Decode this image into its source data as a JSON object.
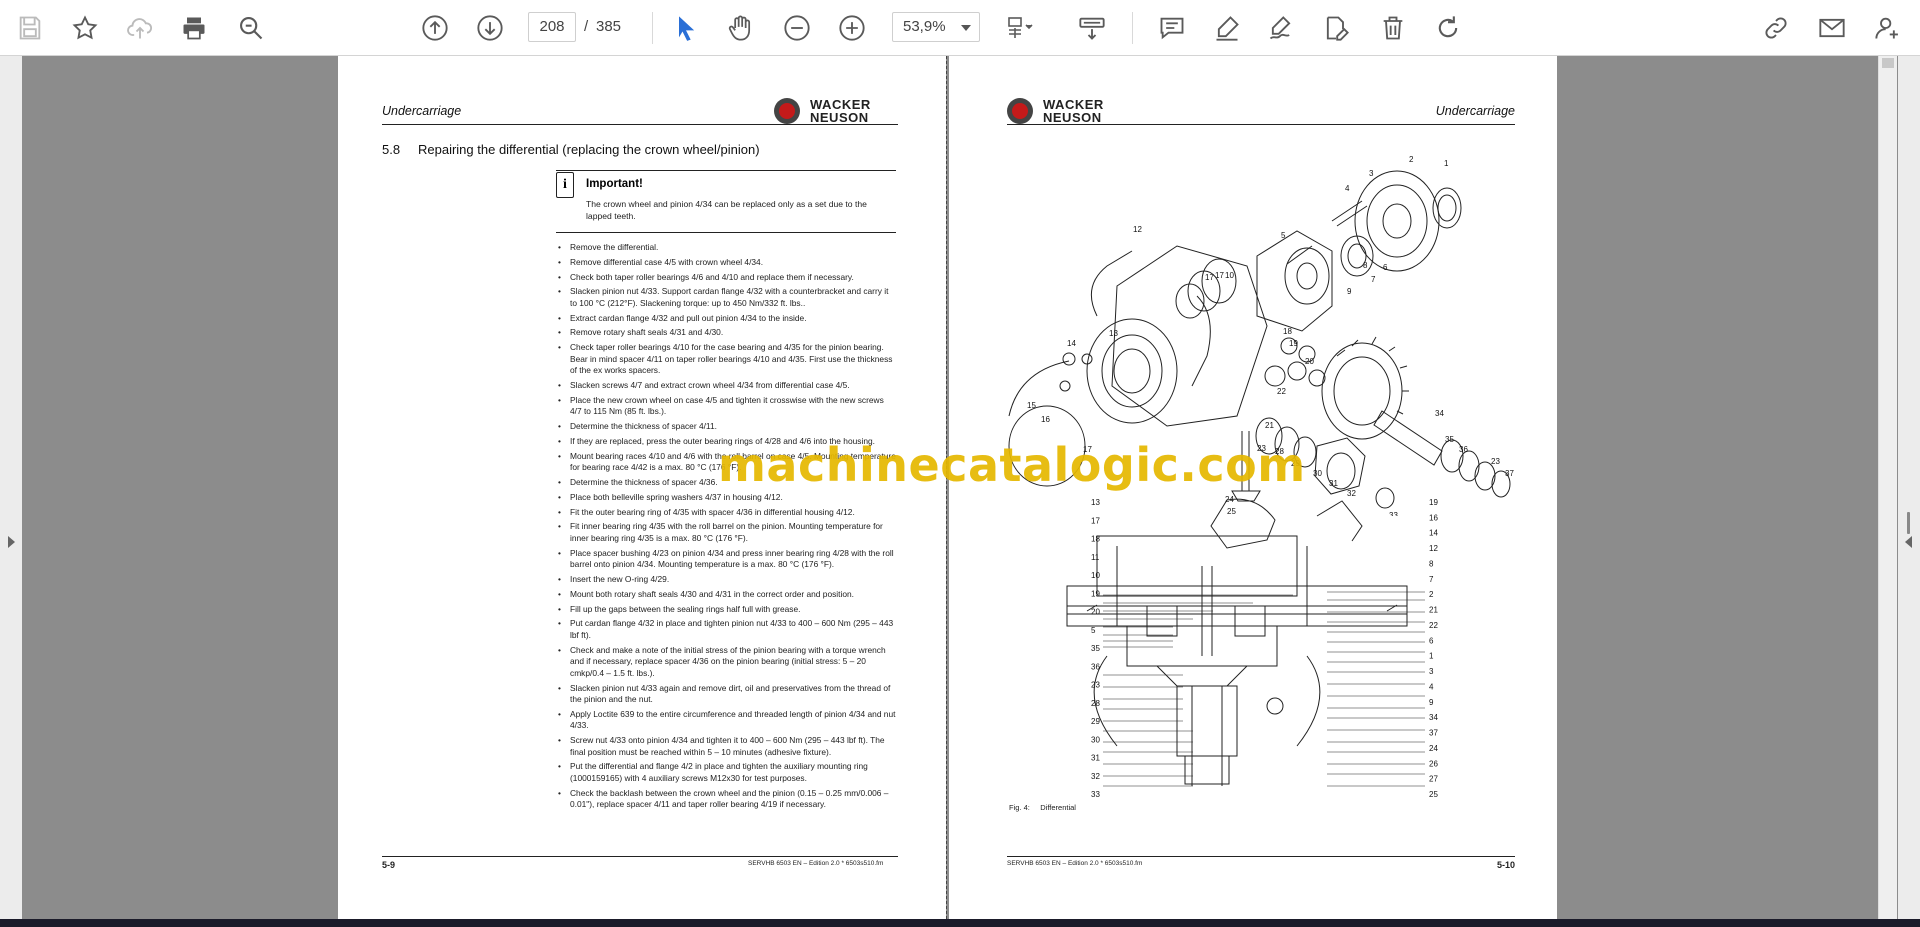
{
  "toolbar": {
    "page_current": "208",
    "page_separator": "/",
    "page_total": "385",
    "zoom": "53,9%"
  },
  "left_page": {
    "header_title": "Undercarriage",
    "logo_line1": "WACKER",
    "logo_line2": "NEUSON",
    "section_number": "5.8",
    "section_title": "Repairing the differential (replacing the crown wheel/pinion)",
    "important_icon": "i",
    "important_title": "Important!",
    "important_text": "The crown wheel and pinion 4/34 can be replaced only as a set due to the lapped teeth.",
    "steps": [
      "Remove the differential.",
      "Remove differential case 4/5 with crown wheel 4/34.",
      "Check both taper roller bearings 4/6 and 4/10 and replace them if necessary.",
      "Slacken pinion nut 4/33. Support cardan flange 4/32 with a counterbracket and carry it to 100 °C (212°F). Slackening torque: up to 450 Nm/332 ft. lbs..",
      "Extract cardan flange 4/32 and pull out pinion 4/34 to the inside.",
      "Remove rotary shaft seals 4/31 and 4/30.",
      "Check taper roller bearings 4/10 for the case bearing and 4/35 for the pinion bearing. Bear in mind spacer 4/11 on taper roller bearings 4/10 and 4/35. First use the thickness of the ex works spacers.",
      "Slacken screws 4/7 and extract crown wheel 4/34 from differential case 4/5.",
      "Place the new crown wheel on case 4/5 and tighten it crosswise with the new screws 4/7 to 115 Nm (85 ft. lbs.).",
      "Determine the thickness of spacer 4/11.",
      "If they are replaced, press the outer bearing rings of 4/28 and 4/6 into the housing.",
      "Mount bearing races 4/10 and 4/6 with the roll barrel on case 4/5. Mounting temperature for bearing race 4/42 is a max. 80 °C (176 °F).",
      "Determine the thickness of spacer 4/36.",
      "Place both belleville spring washers 4/37 in housing 4/12.",
      "Fit the outer bearing ring of 4/35 with spacer 4/36 in differential housing 4/12.",
      "Fit inner bearing ring 4/35 with the roll barrel on the pinion. Mounting temperature for inner bearing ring 4/35 is a max. 80 °C (176 °F).",
      "Place spacer bushing 4/23 on pinion 4/34 and press inner bearing ring 4/28 with the roll barrel onto pinion 4/34. Mounting temperature is a max. 80 °C (176 °F).",
      "Insert the new O-ring 4/29.",
      "Mount both rotary shaft seals 4/30 and 4/31 in the correct order and position.",
      "Fill up the gaps between the sealing rings half full with grease.",
      "Put cardan flange 4/32 in place and tighten pinion nut 4/33 to 400 – 600 Nm (295 – 443 lbf ft).",
      "Check and make a note of the initial stress of the pinion bearing with a torque wrench and if necessary, replace spacer 4/36 on the pinion bearing (initial stress: 5 – 20 cmkp/0.4 – 1.5 ft. lbs.).",
      "Slacken pinion nut 4/33 again and remove dirt, oil and preservatives from the thread of the pinion and the nut.",
      "Apply Loctite 639 to the entire circumference and threaded length of pinion 4/34 and nut 4/33.",
      "Screw nut 4/33 onto pinion 4/34 and tighten it to 400 – 600 Nm (295 – 443 lbf ft). The final position must be reached within 5 – 10 minutes (adhesive fixture).",
      "Put the differential and flange 4/2 in place and tighten the auxiliary mounting ring (1000159165) with 4 auxiliary screws M12x30 for test purposes.",
      "Check the backlash between the crown wheel and the pinion (0.15 – 0.25 mm/0.006 – 0.01\"), replace spacer 4/11 and taper roller bearing 4/19 if necessary."
    ],
    "footer_page": "5-9",
    "footer_doc": "SERVHB 6503 EN – Edition 2.0 * 6503s510.fm"
  },
  "right_page": {
    "header_title": "Undercarriage",
    "logo_line1": "WACKER",
    "logo_line2": "NEUSON",
    "figure_caption_num": "Fig. 4:",
    "figure_caption": "Differential",
    "exploded_labels": [
      "1",
      "2",
      "3",
      "4",
      "5",
      "6",
      "7",
      "8",
      "9",
      "10",
      "11",
      "12",
      "13",
      "14",
      "15",
      "16",
      "17",
      "17",
      "18",
      "19",
      "20",
      "21",
      "22",
      "23",
      "23",
      "24",
      "25",
      "26",
      "27",
      "28",
      "29",
      "30",
      "31",
      "32",
      "33",
      "34",
      "35",
      "36",
      "37"
    ],
    "section_labels_left": [
      "13",
      "17",
      "18",
      "11",
      "10",
      "19",
      "20",
      "5",
      "35",
      "36",
      "23",
      "28",
      "29",
      "30",
      "31",
      "32",
      "33"
    ],
    "section_labels_right": [
      "19",
      "16",
      "14",
      "12",
      "8",
      "7",
      "2",
      "21",
      "22",
      "6",
      "1",
      "3",
      "4",
      "9",
      "34",
      "37",
      "24",
      "26",
      "27",
      "25"
    ],
    "footer_doc": "SERVHB 6503 EN – Edition 2.0 * 6503s510.fm",
    "footer_page": "5-10"
  },
  "watermark": "machinecatalogic.com"
}
